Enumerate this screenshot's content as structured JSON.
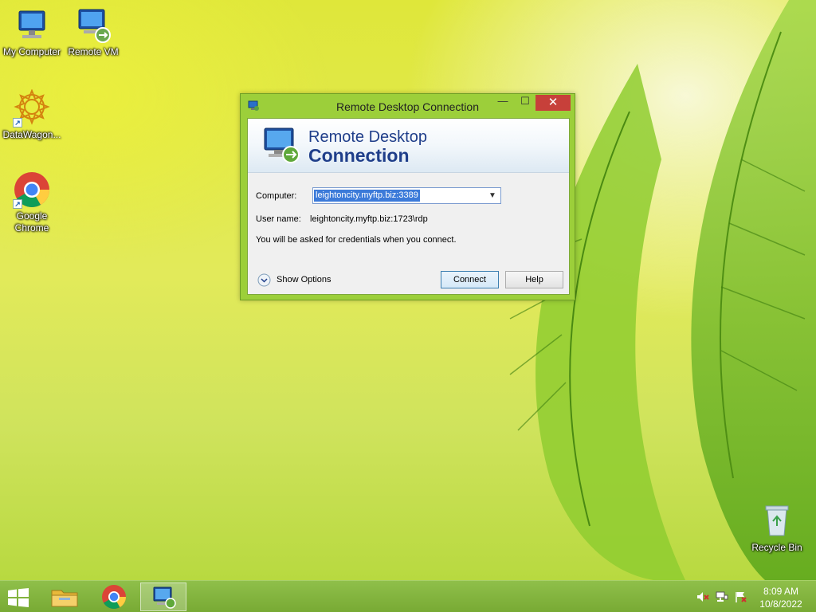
{
  "desktop": {
    "icons": [
      {
        "label": "My Computer",
        "icon": "computer-icon"
      },
      {
        "label": "Remote VM",
        "icon": "remote-desktop-icon"
      },
      {
        "label": "DataWagon...",
        "icon": "datawagon-icon"
      },
      {
        "label": "Google\nChrome",
        "icon": "chrome-icon"
      },
      {
        "label": "Recycle Bin",
        "icon": "recycle-bin-icon"
      }
    ]
  },
  "window": {
    "title": "Remote Desktop Connection",
    "controls": {
      "minimize": "—",
      "maximize": "☐",
      "close": "✕"
    },
    "banner": {
      "line1": "Remote Desktop",
      "line2": "Connection"
    },
    "computer_label": "Computer:",
    "computer_value": "leightoncity.myftp.biz:3389",
    "username_label": "User name:",
    "username_value": "leightoncity.myftp.biz:1723\\rdp",
    "credentials_note": "You will be asked for credentials when you connect.",
    "show_options": "Show Options",
    "connect_button": "Connect",
    "help_button": "Help"
  },
  "taskbar": {
    "items": [
      "start-icon",
      "file-explorer-icon",
      "chrome-icon",
      "remote-desktop-icon"
    ],
    "active_item": "remote-desktop-icon",
    "tray": [
      "speaker-muted-icon",
      "network-icon",
      "action-center-flag-icon"
    ],
    "time": "8:09 AM",
    "date": "10/8/2022"
  },
  "colors": {
    "taskbar": "#7fb23a",
    "window_frame": "#9ccf3a",
    "close_button": "#c7403a",
    "banner_text": "#1f3e8a",
    "selection": "#3b7ad9"
  }
}
